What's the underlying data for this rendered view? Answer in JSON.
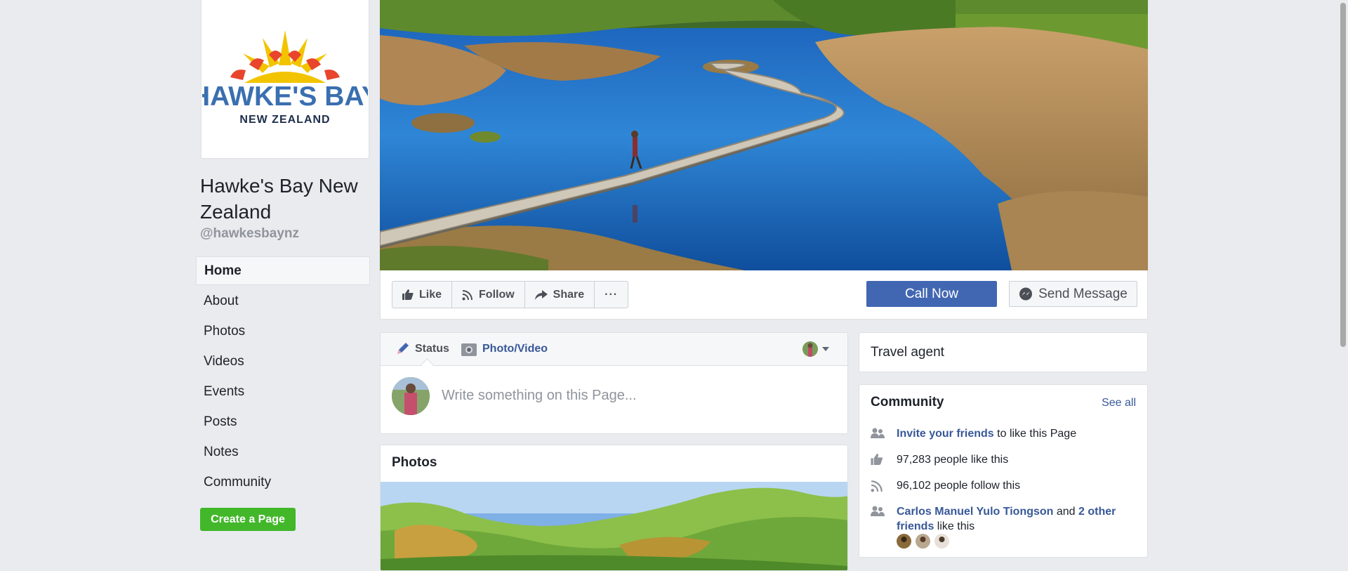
{
  "page": {
    "name": "Hawke's Bay New Zealand",
    "handle": "@hawkesbaynz",
    "logo_text": "HAWKE'S BAY",
    "logo_subtext": "NEW ZEALAND"
  },
  "nav": {
    "items": [
      {
        "label": "Home",
        "active": true
      },
      {
        "label": "About"
      },
      {
        "label": "Photos"
      },
      {
        "label": "Videos"
      },
      {
        "label": "Events"
      },
      {
        "label": "Posts"
      },
      {
        "label": "Notes"
      },
      {
        "label": "Community"
      }
    ],
    "create_page": "Create a Page"
  },
  "actions": {
    "like": "Like",
    "follow": "Follow",
    "share": "Share",
    "more": "···",
    "call_now": "Call Now",
    "send_message": "Send Message"
  },
  "composer": {
    "status_tab": "Status",
    "photo_tab": "Photo/Video",
    "placeholder": "Write something on this Page..."
  },
  "photos": {
    "title": "Photos"
  },
  "category": "Travel agent",
  "community": {
    "title": "Community",
    "see_all": "See all",
    "invite_link": "Invite your friends",
    "invite_rest": " to like this Page",
    "likes_text": "97,283 people like this",
    "follows_text": "96,102 people follow this",
    "friend_name": "Carlos Manuel Yulo Tiongson",
    "friend_and": " and ",
    "others_link": "2 other friends",
    "friends_rest": " like this"
  },
  "colors": {
    "brand_blue": "#4267b2",
    "link_blue": "#385898",
    "green": "#42b72a",
    "background": "#e9ebee"
  },
  "icons": [
    "thumbs-up-icon",
    "rss-icon",
    "share-arrow-icon",
    "more-icon",
    "messenger-icon",
    "pencil-icon",
    "camera-icon",
    "people-icon",
    "chevron-down-icon"
  ]
}
